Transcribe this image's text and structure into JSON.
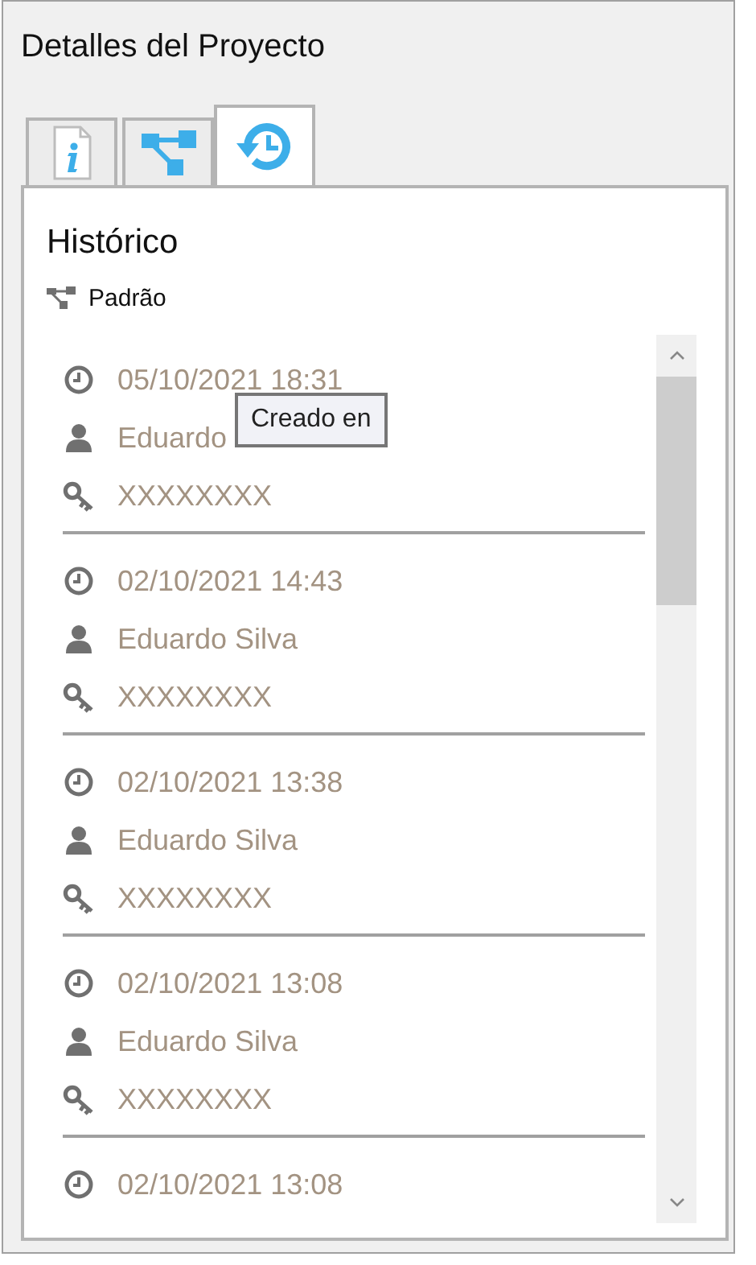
{
  "window": {
    "title": "Detalles del Proyecto"
  },
  "tabs": [
    {
      "selected": false
    },
    {
      "selected": false
    },
    {
      "selected": true
    }
  ],
  "panel": {
    "heading": "Histórico",
    "branch": "Padrão"
  },
  "entries": [
    {
      "date": "05/10/2021 18:31",
      "user": "Eduardo",
      "key": "XXXXXXXX"
    },
    {
      "date": "02/10/2021 14:43",
      "user": "Eduardo Silva",
      "key": "XXXXXXXX"
    },
    {
      "date": "02/10/2021 13:38",
      "user": "Eduardo Silva",
      "key": "XXXXXXXX"
    },
    {
      "date": "02/10/2021 13:08",
      "user": "Eduardo Silva",
      "key": "XXXXXXXX"
    },
    {
      "date": "02/10/2021 13:08"
    }
  ],
  "tooltip": {
    "text": "Creado en"
  }
}
